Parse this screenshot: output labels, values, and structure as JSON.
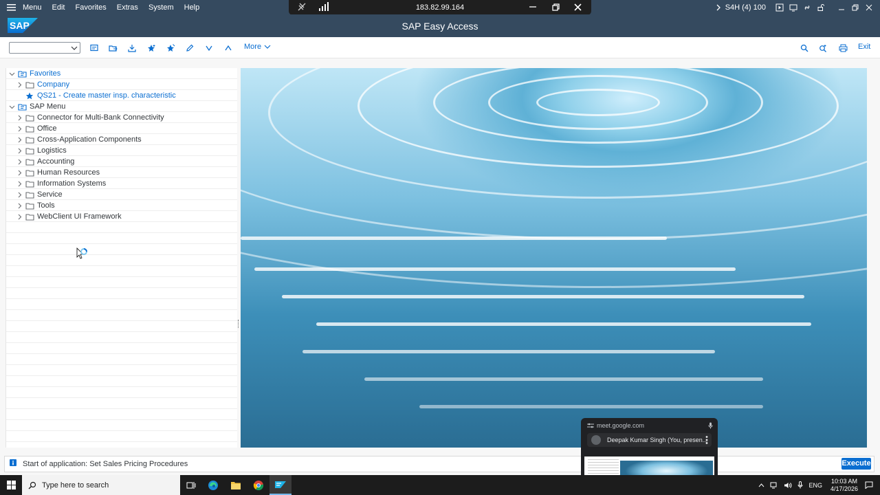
{
  "menubar": {
    "items": [
      {
        "label": "Menu"
      },
      {
        "label": "Edit"
      },
      {
        "label": "Favorites"
      },
      {
        "label": "Extras"
      },
      {
        "label": "System"
      },
      {
        "label": "Help"
      }
    ],
    "system_info": "S4H (4) 100"
  },
  "remote": {
    "ip": "183.82.99.164"
  },
  "titlebar": {
    "title": "SAP Easy Access",
    "logo_text": "SAP"
  },
  "toolbar": {
    "more_label": "More",
    "exit_label": "Exit",
    "command_value": ""
  },
  "tree": {
    "rows": [
      {
        "label": "Favorites",
        "level": 0,
        "icon": "favorites-folder-icon",
        "expanded": true,
        "link": true
      },
      {
        "label": "Company",
        "level": 1,
        "icon": "folder-icon",
        "expanded": false,
        "link": true
      },
      {
        "label": "QS21 - Create master insp. characteristic",
        "level": 1,
        "icon": "star-icon",
        "expanded": null,
        "link": true
      },
      {
        "label": "SAP Menu",
        "level": 0,
        "icon": "menu-folder-icon",
        "expanded": true,
        "link": false
      },
      {
        "label": "Connector for Multi-Bank Connectivity",
        "level": 1,
        "icon": "folder-icon",
        "expanded": false,
        "link": false
      },
      {
        "label": "Office",
        "level": 1,
        "icon": "folder-icon",
        "expanded": false,
        "link": false
      },
      {
        "label": "Cross-Application Components",
        "level": 1,
        "icon": "folder-icon",
        "expanded": false,
        "link": false
      },
      {
        "label": "Logistics",
        "level": 1,
        "icon": "folder-icon",
        "expanded": false,
        "link": false
      },
      {
        "label": "Accounting",
        "level": 1,
        "icon": "folder-icon",
        "expanded": false,
        "link": false
      },
      {
        "label": "Human Resources",
        "level": 1,
        "icon": "folder-icon",
        "expanded": false,
        "link": false
      },
      {
        "label": "Information Systems",
        "level": 1,
        "icon": "folder-icon",
        "expanded": false,
        "link": false
      },
      {
        "label": "Service",
        "level": 1,
        "icon": "folder-icon",
        "expanded": false,
        "link": false
      },
      {
        "label": "Tools",
        "level": 1,
        "icon": "folder-icon",
        "expanded": false,
        "link": false
      },
      {
        "label": "WebClient UI Framework",
        "level": 1,
        "icon": "folder-icon",
        "expanded": false,
        "link": false
      }
    ]
  },
  "meet": {
    "url": "meet.google.com",
    "participant": "Deepak Kumar Singh (You, presen..."
  },
  "status": {
    "message": "Start of application: Set Sales Pricing Procedures",
    "execute_label": "Execute"
  },
  "taskbar": {
    "search_placeholder": "Type here to search",
    "language": "ENG",
    "time": "10:03 AM",
    "date": "4/17/2026"
  },
  "colors": {
    "shell": "#354a5f",
    "accent": "#0a6ed1",
    "taskbar": "#1c1c1c"
  }
}
